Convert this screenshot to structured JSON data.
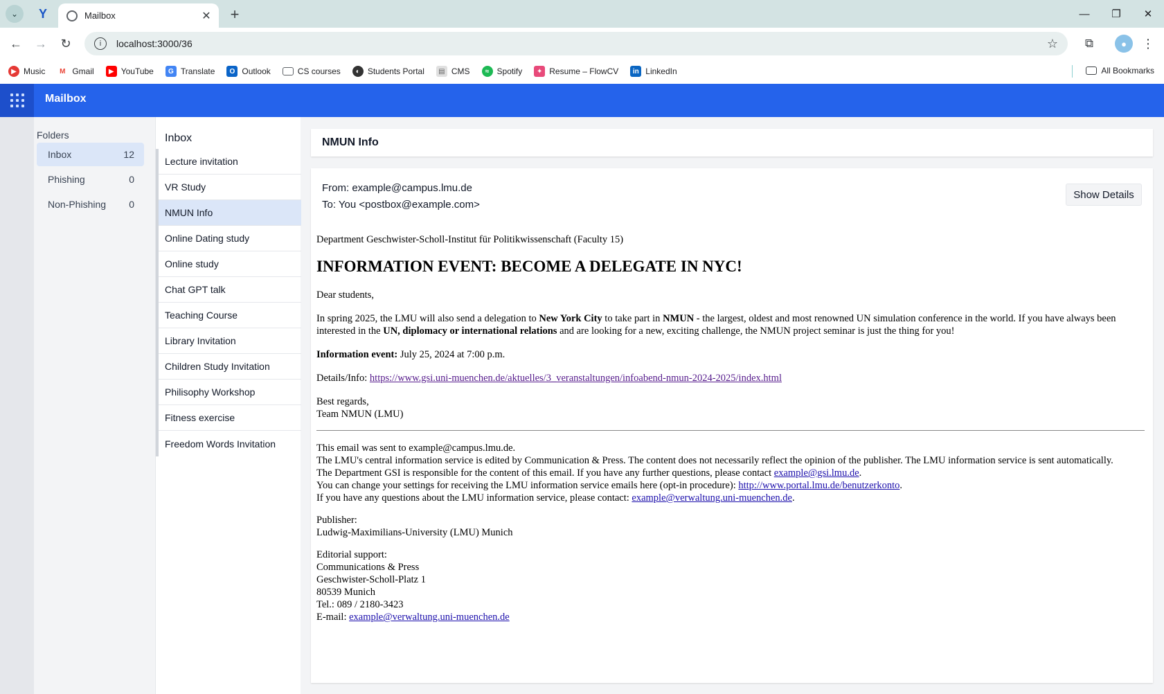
{
  "browser": {
    "tab_title": "Mailbox",
    "url": "localhost:3000/36",
    "bookmarks": [
      {
        "label": "Music",
        "icon": "music-icon",
        "color": "#e53935"
      },
      {
        "label": "Gmail",
        "icon": "gmail-icon",
        "color": "#ea4335"
      },
      {
        "label": "YouTube",
        "icon": "youtube-icon",
        "color": "#ff0000"
      },
      {
        "label": "Translate",
        "icon": "translate-icon",
        "color": "#4285f4"
      },
      {
        "label": "Outlook",
        "icon": "outlook-icon",
        "color": "#0a64c8"
      },
      {
        "label": "CS courses",
        "icon": "folder-icon",
        "color": "#5f6368"
      },
      {
        "label": "Students Portal",
        "icon": "globe-icon",
        "color": "#333333"
      },
      {
        "label": "CMS",
        "icon": "cms-icon",
        "color": "#888888"
      },
      {
        "label": "Spotify",
        "icon": "spotify-icon",
        "color": "#1db954"
      },
      {
        "label": "Resume – FlowCV",
        "icon": "flowcv-icon",
        "color": "#e84a7a"
      },
      {
        "label": "LinkedIn",
        "icon": "linkedin-icon",
        "color": "#0a66c2"
      }
    ],
    "all_bookmarks": "All Bookmarks"
  },
  "app": {
    "title": "Mailbox",
    "accent": "#2563eb"
  },
  "folders": {
    "title": "Folders",
    "items": [
      {
        "label": "Inbox",
        "count": "12"
      },
      {
        "label": "Phishing",
        "count": "0"
      },
      {
        "label": "Non-Phishing",
        "count": "0"
      }
    ]
  },
  "inbox": {
    "title": "Inbox",
    "items": [
      "Lecture invitation",
      "VR Study",
      "NMUN Info",
      "Online Dating study",
      "Online study",
      "Chat GPT talk",
      "Teaching Course",
      "Library Invitation",
      "Children Study Invitation",
      "Philisophy Workshop",
      "Fitness exercise",
      "Freedom Words Invitation"
    ],
    "selected": "NMUN Info"
  },
  "email": {
    "subject": "NMUN Info",
    "from": "From: example@campus.lmu.de",
    "to": "To: You <postbox@example.com>",
    "show_details": "Show Details",
    "department": "Department Geschwister-Scholl-Institut für Politikwissenschaft (Faculty 15)",
    "headline": "INFORMATION EVENT: BECOME A DELEGATE IN NYC!",
    "greeting": "Dear students,",
    "para1_a": "In spring 2025, the LMU will also send a delegation to ",
    "para1_b": "New York City",
    "para1_c": " to take part in ",
    "para1_d": "NMUN",
    "para1_e": " - the largest, oldest and most renowned UN simulation conference in the world. If you have always been interested in the ",
    "para1_f": "UN, diplomacy or international relations",
    "para1_g": " and are looking for a new, exciting challenge, the NMUN project seminar is just the thing for you!",
    "event_label": "Information event:",
    "event_value": " July 25, 2024 at 7:00 p.m.",
    "details_label": "Details/Info: ",
    "details_link": "https://www.gsi.uni-muenchen.de/aktuelles/3_veranstaltungen/infoabend-nmun-2024-2025/index.html",
    "regards": "Best regards,",
    "team": "Team NMUN (LMU)",
    "footer": {
      "sent_to": "This email was sent to example@campus.lmu.de.",
      "central": "The LMU's central information service is edited by Communication & Press. The content does not necessarily reflect the opinion of the publisher. The LMU information service is sent automatically.",
      "gsi_a": "The Department GSI is responsible for the content of this email. If you have any further questions, please contact ",
      "gsi_link": "example@gsi.lmu.de",
      "gsi_end": ".",
      "settings_a": "You can change your settings for receiving the LMU information service emails here (opt-in procedure): ",
      "settings_link": "http://www.portal.lmu.de/benutzerkonto",
      "settings_end": ".",
      "questions_a": "If you have any questions about the LMU information service, please contact: ",
      "questions_link": "example@verwaltung.uni-muenchen.de",
      "questions_end": ".",
      "publisher_label": "Publisher:",
      "publisher": "Ludwig-Maximilians-University (LMU) Munich",
      "editorial_label": "Editorial support:",
      "editorial_1": "Communications & Press",
      "editorial_2": "Geschwister-Scholl-Platz 1",
      "editorial_3": "80539 Munich",
      "tel": "Tel.: 089 / 2180-3423",
      "email_label": "E-mail: ",
      "email_link": "example@verwaltung.uni-muenchen.de"
    }
  }
}
